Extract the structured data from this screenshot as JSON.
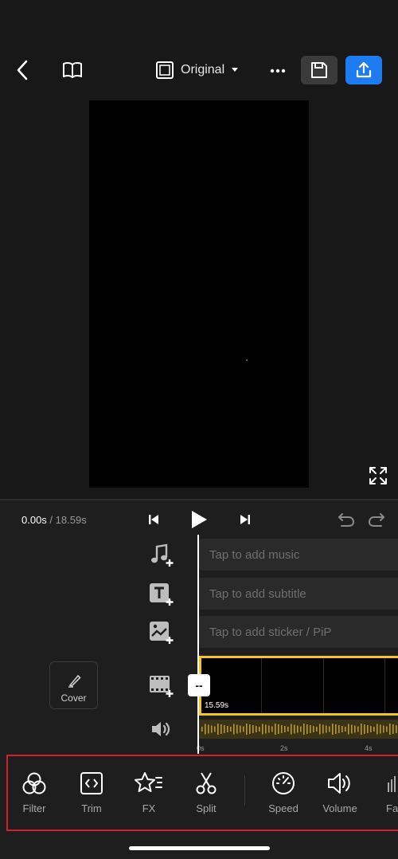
{
  "header": {
    "aspect_label": "Original"
  },
  "playback": {
    "current_time": "0.00s",
    "separator": " / ",
    "total_time": "18.59s"
  },
  "tracks": {
    "music": "Tap to add music",
    "subtitle": "Tap to add subtitle",
    "sticker": "Tap to add sticker / PiP"
  },
  "timeline": {
    "clip_duration": "15.59s",
    "handle_label": "--",
    "ruler": [
      "0s",
      "2s",
      "4s"
    ]
  },
  "cover_label": "Cover",
  "tools": [
    {
      "label": "Filter"
    },
    {
      "label": "Trim"
    },
    {
      "label": "FX"
    },
    {
      "label": "Split"
    },
    {
      "label": "Speed"
    },
    {
      "label": "Volume"
    },
    {
      "label": "Fa"
    }
  ],
  "colors": {
    "accent_blue": "#1d7cf2",
    "clip_border": "#f5c518",
    "highlight_red": "#d4202a"
  }
}
